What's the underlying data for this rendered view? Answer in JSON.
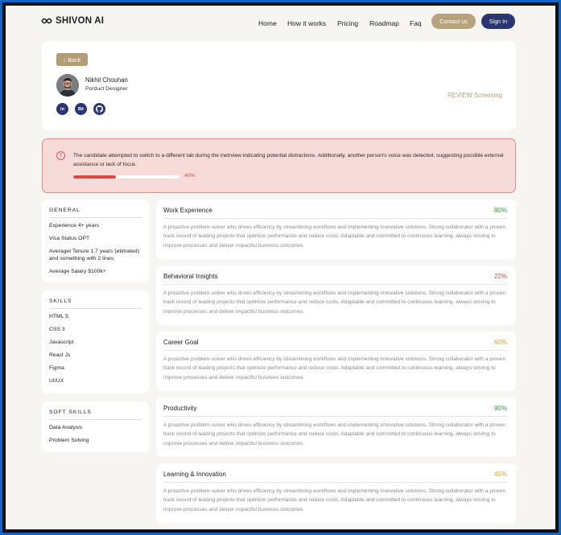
{
  "nav": {
    "logo": "SHIVON AI",
    "links": [
      "Home",
      "How it works",
      "Pricing",
      "Roadmap",
      "Faq"
    ],
    "contact_label": "Contact us",
    "signin_label": "Sign In"
  },
  "profile": {
    "back_label": "Back",
    "name": "Nikhil Chouhan",
    "role": "Porduct Designer",
    "socials": [
      "in",
      "Bē",
      "gh"
    ],
    "review_status": "REVIEW Screening"
  },
  "alert": {
    "message": "The candidate attempted to switch to a different tab during the inetrview indicating potential distractions. Additionally, another person's voice was detected, suggesting possible external assistance or lack of focus.",
    "progress_label": "40%",
    "progress_value": 0.4,
    "color": "#d44c44"
  },
  "general": {
    "title": "GENERAL",
    "items": [
      "Experience 4+ years",
      "Visa Status OPT",
      "Averaget Tenure 1.7 years (etimated) and something with 2 lines",
      "Average Salary $100k+"
    ]
  },
  "skills": {
    "title": "SKILLS",
    "items": [
      "HTML 5",
      "CSS 3",
      "Javascript",
      "React Js",
      "Figma",
      "UI/UX"
    ]
  },
  "soft_skills": {
    "title": "SOFT SKILLS",
    "items": [
      "Data Analysis",
      "Problem Solving"
    ]
  },
  "evaluations": [
    {
      "title": "Work Experience",
      "score": "80%",
      "color": "#2e9d3a",
      "desc": "A proactive problem-solver who drives efficiency by streamlining workflows and implementing innovative solutions. Strong collaborator with a proven track record of leading projects that optimize performance and reduce costs. Adaptable and committed to continuous learning, always striving to improve processes and deliver impactful business outcomes."
    },
    {
      "title": "Behavioral Insights",
      "score": "22%",
      "color": "#d7453c",
      "desc": "A proactive problem-solver who drives efficiency by streamlining workflows and implementing innovative solutions. Strong collaborator with a proven track record of leading projects that optimize performance and reduce costs. Adaptable and committed to continuous learning, always striving to improve processes and deliver impactful business outcomes."
    },
    {
      "title": "Career Goal",
      "score": "60%",
      "color": "#e0a12b",
      "desc": "A proactive problem-solver who drives efficiency by streamlining workflows and implementing innovative solutions. Strong collaborator with a proven track record of leading projects that optimize performance and reduce costs. Adaptable and committed to continuous learning, always striving to improve processes and deliver impactful business outcomes."
    },
    {
      "title": "Productivity",
      "score": "90%",
      "color": "#2e9d3a",
      "desc": "A proactive problem-solver who drives efficiency by streamlining workflows and implementing innovative solutions. Strong collaborator with a proven track record of leading projects that optimize performance and reduce costs. Adaptable and committed to continuous learning, always striving to improve processes and deliver impactful business outcomes."
    },
    {
      "title": "Learning & Innovation",
      "score": "45%",
      "color": "#e0a12b",
      "desc": "A proactive problem-solver who drives efficiency by streamlining workflows and implementing innovative solutions. Strong collaborator with a proven track record of leading projects that optimize performance and reduce costs. Adaptable and committed to continuous learning, always striving to improve processes and deliver impactful business outcomes."
    }
  ]
}
